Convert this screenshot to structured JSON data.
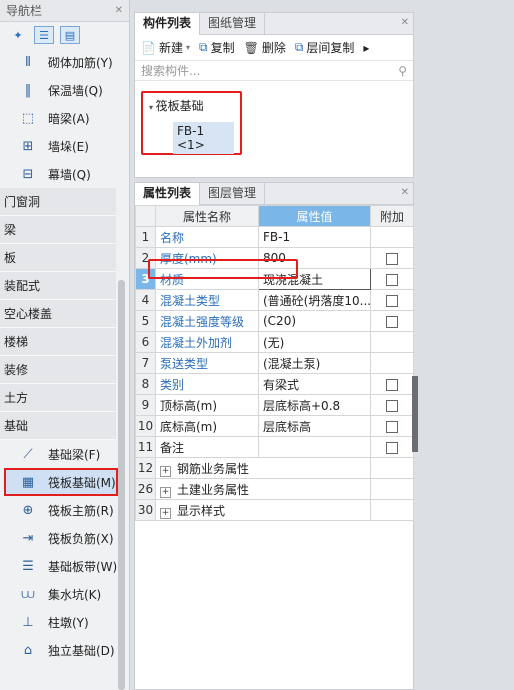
{
  "nav": {
    "title": "导航栏",
    "close": "✕",
    "top_items": [
      {
        "icon": "brick-rebar",
        "label": "砌体加筋(Y)"
      },
      {
        "icon": "insulation-wall",
        "label": "保温墙(Q)"
      },
      {
        "icon": "hidden-beam",
        "label": "暗梁(A)"
      },
      {
        "icon": "wall-pier",
        "label": "墙垛(E)"
      },
      {
        "icon": "curtain-wall",
        "label": "幕墙(Q)"
      }
    ],
    "categories": [
      "门窗洞",
      "梁",
      "板",
      "装配式",
      "空心楼盖",
      "楼梯",
      "装修",
      "土方",
      "基础"
    ],
    "sub_items": [
      {
        "icon": "foundation-beam",
        "label": "基础梁(F)"
      },
      {
        "icon": "raft-foundation",
        "label": "筏板基础(M)",
        "selected": true
      },
      {
        "icon": "raft-main-rebar",
        "label": "筏板主筋(R)"
      },
      {
        "icon": "raft-negative-rebar",
        "label": "筏板负筋(X)"
      },
      {
        "icon": "foundation-strip",
        "label": "基础板带(W)"
      },
      {
        "icon": "sump",
        "label": "集水坑(K)"
      },
      {
        "icon": "column-pier",
        "label": "柱墩(Y)"
      },
      {
        "icon": "isolated-footing",
        "label": "独立基础(D)"
      }
    ]
  },
  "comp": {
    "tabs": [
      "构件列表",
      "图纸管理"
    ],
    "close": "✕",
    "toolbar": {
      "new": "新建",
      "copy": "复制",
      "delete": "删除",
      "floor_copy": "层间复制",
      "more": "▸"
    },
    "search_placeholder": "搜索构件...",
    "tree": {
      "group": "筏板基础",
      "node": "FB-1 <1>"
    }
  },
  "props": {
    "tabs": [
      "属性列表",
      "图层管理"
    ],
    "close": "✕",
    "headers": [
      "属性名称",
      "属性值",
      "附加"
    ],
    "rows": [
      {
        "n": "1",
        "name": "名称",
        "value": "FB-1",
        "blue": true,
        "check": false
      },
      {
        "n": "2",
        "name": "厚度(mm)",
        "value": "800",
        "blue": true,
        "check": true
      },
      {
        "n": "3",
        "name": "材质",
        "value": "现浇混凝土",
        "blue": true,
        "check": true
      },
      {
        "n": "4",
        "name": "混凝土类型",
        "value": "(普通砼(坍落度10...",
        "blue": true,
        "check": true
      },
      {
        "n": "5",
        "name": "混凝土强度等级",
        "value": "(C20)",
        "blue": true,
        "check": true
      },
      {
        "n": "6",
        "name": "混凝土外加剂",
        "value": "(无)",
        "blue": true,
        "check": false
      },
      {
        "n": "7",
        "name": "泵送类型",
        "value": "(混凝土泵)",
        "blue": true,
        "check": false
      },
      {
        "n": "8",
        "name": "类别",
        "value": "有梁式",
        "blue": true,
        "check": true
      },
      {
        "n": "9",
        "name": "顶标高(m)",
        "value": "层底标高+0.8",
        "blue": false,
        "check": true
      },
      {
        "n": "10",
        "name": "底标高(m)",
        "value": "层底标高",
        "blue": false,
        "check": true
      },
      {
        "n": "11",
        "name": "备注",
        "value": "",
        "blue": false,
        "check": true
      }
    ],
    "groups": [
      {
        "n": "12",
        "label": "钢筋业务属性"
      },
      {
        "n": "26",
        "label": "土建业务属性"
      },
      {
        "n": "30",
        "label": "显示样式"
      }
    ]
  }
}
